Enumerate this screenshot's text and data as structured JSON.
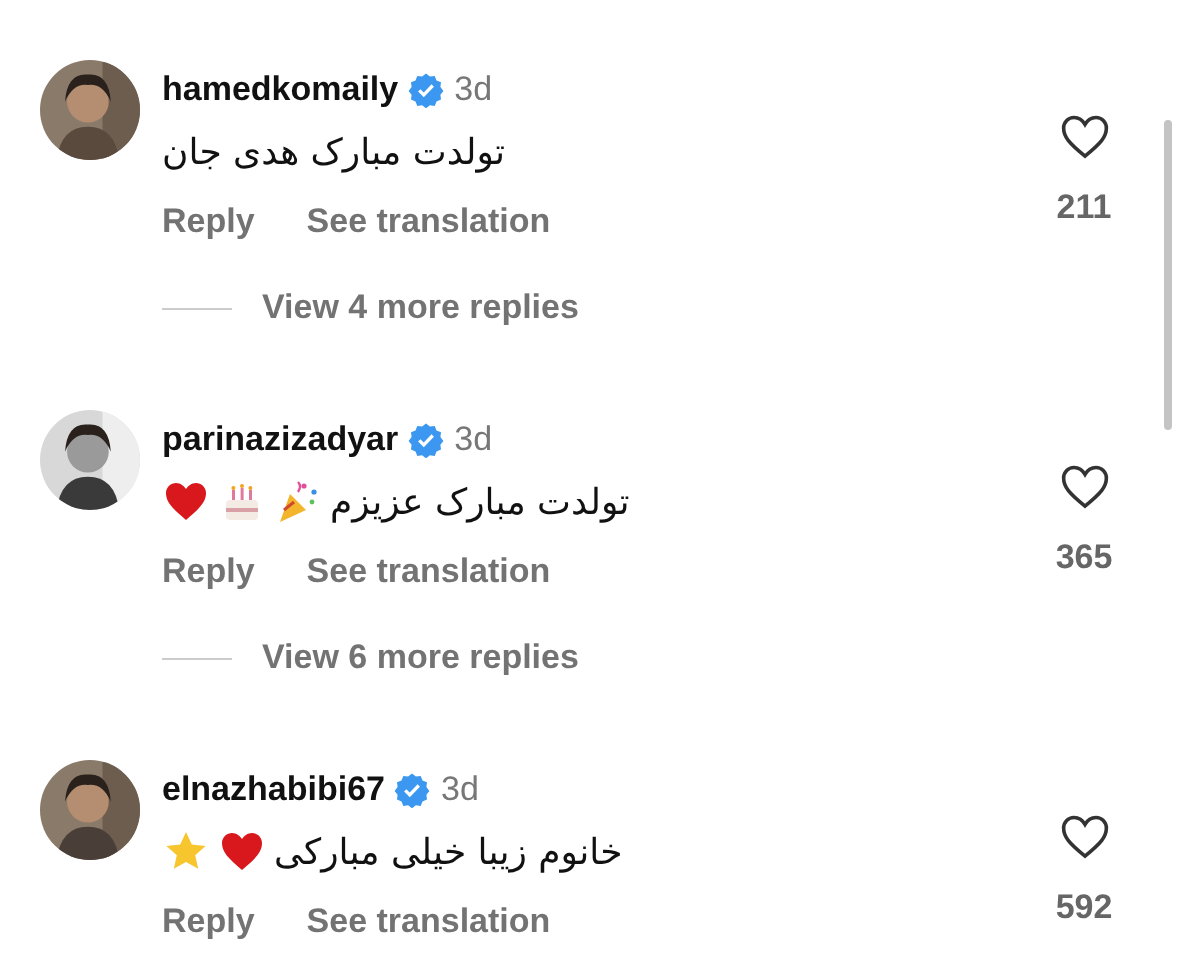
{
  "comments": [
    {
      "username": "hamedkomaily",
      "verified": true,
      "time": "3d",
      "text": "تولدت مبارک هدی جان",
      "reply": "Reply",
      "translate": "See translation",
      "likes": "211",
      "liked": false,
      "more_replies": "View 4 more replies"
    },
    {
      "username": "parinazizadyar",
      "verified": true,
      "time": "3d",
      "text": "تولدت مبارک عزیزم",
      "emojis": [
        {
          "kind": "party"
        },
        {
          "kind": "cake"
        },
        {
          "kind": "heart"
        }
      ],
      "reply": "Reply",
      "translate": "See translation",
      "likes": "365",
      "liked": false,
      "more_replies": "View 6 more replies"
    },
    {
      "username": "elnazhabibi67",
      "verified": true,
      "time": "3d",
      "text": "خانوم زیبا خیلی مبارکی",
      "emojis": [
        {
          "kind": "heart"
        },
        {
          "kind": "star"
        }
      ],
      "reply": "Reply",
      "translate": "See translation",
      "likes": "592",
      "liked": false
    }
  ]
}
